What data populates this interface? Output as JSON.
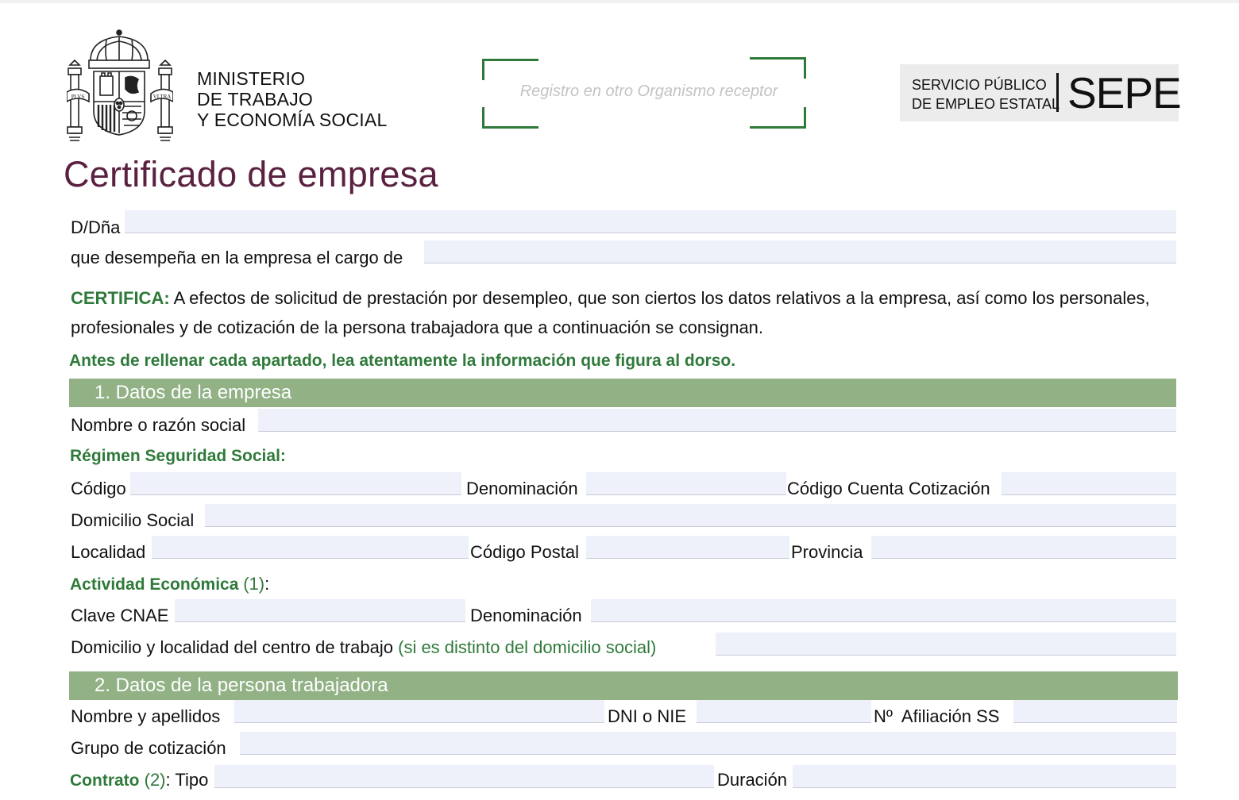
{
  "header": {
    "ministry_line1": "MINISTERIO",
    "ministry_line2": "DE TRABAJO",
    "ministry_line3": "Y ECONOMÍA SOCIAL",
    "registry_placeholder": "Registro en otro Organismo receptor",
    "sepe_line1": "SERVICIO PÚBLICO",
    "sepe_line2": "DE EMPLEO ESTATAL",
    "sepe_logo": "SEPE",
    "coat_motto_left": "PLVS",
    "coat_motto_right": "VLTRA"
  },
  "form_title": "Certificado de empresa",
  "intro": {
    "ddna_label": "D/Dña",
    "cargo_label": "que desempeña en la empresa el cargo de",
    "certifica_label": "CERTIFICA:",
    "certifica_text_1": "A efectos de solicitud de prestación por desempleo, que son ciertos los datos relativos a la empresa, así como los personales,",
    "certifica_text_2": "profesionales y de cotización de la persona trabajadora que a continuación se consignan.",
    "warning": "Antes de rellenar cada apartado, lea atentamente la información que figura al dorso."
  },
  "section1": {
    "title": "1. Datos de la empresa",
    "nombre_label": "Nombre o razón social",
    "regimen_label": "Régimen Seguridad Social:",
    "codigo_label": "Código",
    "denominacion_label": "Denominación",
    "ccc_label": "Código Cuenta Cotización",
    "domicilio_label": "Domicilio Social",
    "localidad_label": "Localidad",
    "cp_label": "Código Postal",
    "provincia_label": "Provincia",
    "actividad_label": "Actividad Económica",
    "actividad_ref": "(1)",
    "actividad_colon": ":",
    "cnae_label": "Clave CNAE",
    "denominacion2_label": "Denominación",
    "centro_label": "Domicilio y localidad del centro de trabajo",
    "centro_note": "(si es distinto del domicilio social)"
  },
  "section2": {
    "title": "2. Datos de la persona trabajadora",
    "nombre_label": "Nombre y apellidos",
    "dni_label": "DNI o NIE",
    "afiliacion_label": "Nº  Afiliación SS",
    "grupo_label": "Grupo de cotización",
    "contrato_label": "Contrato",
    "contrato_ref": "(2)",
    "tipo_label": ": Tipo",
    "duracion_label": "Duración"
  }
}
